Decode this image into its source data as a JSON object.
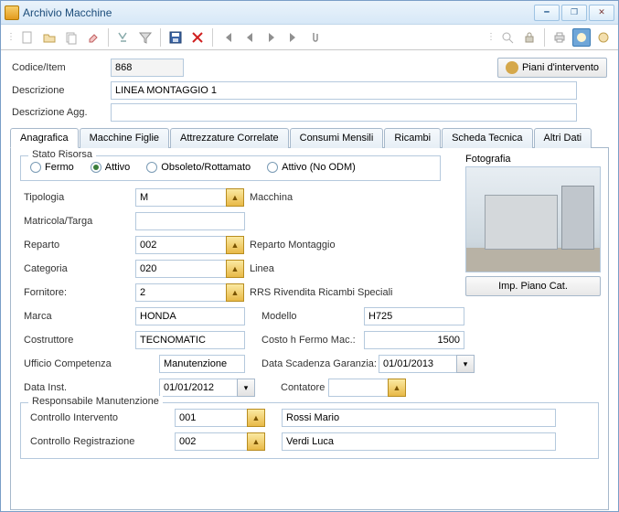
{
  "window": {
    "title": "Archivio Macchine"
  },
  "toolbar": {
    "piano_btn": "Piani d'intervento"
  },
  "header": {
    "codice_label": "Codice/Item",
    "codice_value": "868",
    "descrizione_label": "Descrizione",
    "descrizione_value": "LINEA MONTAGGIO 1",
    "descrizione_agg_label": "Descrizione Agg.",
    "descrizione_agg_value": ""
  },
  "tabs": {
    "anagrafica": "Anagrafica",
    "macchine_figlie": "Macchine Figlie",
    "attrezzature": "Attrezzature Correlate",
    "consumi": "Consumi Mensili",
    "ricambi": "Ricambi",
    "scheda": "Scheda Tecnica",
    "altri": "Altri Dati"
  },
  "anagrafica": {
    "stato_legend": "Stato Risorsa",
    "stato_options": {
      "fermo": "Fermo",
      "attivo": "Attivo",
      "obsoleto": "Obsoleto/Rottamato",
      "noodm": "Attivo (No ODM)"
    },
    "fotografia_label": "Fotografia",
    "imp_piano_btn": "Imp. Piano Cat.",
    "tipologia_label": "Tipologia",
    "tipologia_value": "M",
    "tipologia_desc": "Macchina",
    "matricola_label": "Matricola/Targa",
    "matricola_value": "",
    "reparto_label": "Reparto",
    "reparto_value": "002",
    "reparto_desc": "Reparto Montaggio",
    "categoria_label": "Categoria",
    "categoria_value": "020",
    "categoria_desc": "Linea",
    "fornitore_label": "Fornitore:",
    "fornitore_value": "2",
    "fornitore_desc": "RRS Rivendita Ricambi Speciali",
    "marca_label": "Marca",
    "marca_value": "HONDA",
    "modello_label": "Modello",
    "modello_value": "H725",
    "costruttore_label": "Costruttore",
    "costruttore_value": "TECNOMATIC",
    "costo_label": "Costo h Fermo Mac.:",
    "costo_value": "1500",
    "ufficio_label": "Ufficio Competenza",
    "ufficio_value": "Manutenzione",
    "scadenza_label": "Data Scadenza Garanzia:",
    "scadenza_value": "01/01/2013",
    "data_inst_label": "Data Inst.",
    "data_inst_value": "01/01/2012",
    "contatore_label": "Contatore",
    "contatore_value": "",
    "resp_legend": "Responsabile Manutenzione",
    "ctrl_int_label": "Controllo Intervento",
    "ctrl_int_value": "001",
    "ctrl_int_desc": "Rossi Mario",
    "ctrl_reg_label": "Controllo Registrazione",
    "ctrl_reg_value": "002",
    "ctrl_reg_desc": "Verdi Luca"
  }
}
